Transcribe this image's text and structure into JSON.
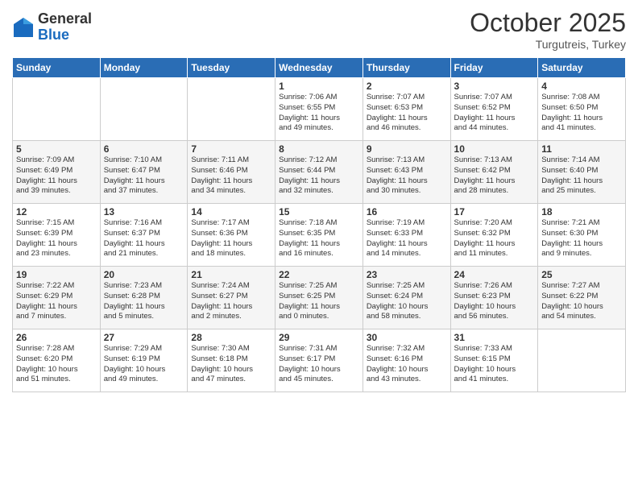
{
  "logo": {
    "general": "General",
    "blue": "Blue"
  },
  "header": {
    "month": "October 2025",
    "location": "Turgutreis, Turkey"
  },
  "days_of_week": [
    "Sunday",
    "Monday",
    "Tuesday",
    "Wednesday",
    "Thursday",
    "Friday",
    "Saturday"
  ],
  "weeks": [
    [
      {
        "day": "",
        "info": ""
      },
      {
        "day": "",
        "info": ""
      },
      {
        "day": "",
        "info": ""
      },
      {
        "day": "1",
        "info": "Sunrise: 7:06 AM\nSunset: 6:55 PM\nDaylight: 11 hours\nand 49 minutes."
      },
      {
        "day": "2",
        "info": "Sunrise: 7:07 AM\nSunset: 6:53 PM\nDaylight: 11 hours\nand 46 minutes."
      },
      {
        "day": "3",
        "info": "Sunrise: 7:07 AM\nSunset: 6:52 PM\nDaylight: 11 hours\nand 44 minutes."
      },
      {
        "day": "4",
        "info": "Sunrise: 7:08 AM\nSunset: 6:50 PM\nDaylight: 11 hours\nand 41 minutes."
      }
    ],
    [
      {
        "day": "5",
        "info": "Sunrise: 7:09 AM\nSunset: 6:49 PM\nDaylight: 11 hours\nand 39 minutes."
      },
      {
        "day": "6",
        "info": "Sunrise: 7:10 AM\nSunset: 6:47 PM\nDaylight: 11 hours\nand 37 minutes."
      },
      {
        "day": "7",
        "info": "Sunrise: 7:11 AM\nSunset: 6:46 PM\nDaylight: 11 hours\nand 34 minutes."
      },
      {
        "day": "8",
        "info": "Sunrise: 7:12 AM\nSunset: 6:44 PM\nDaylight: 11 hours\nand 32 minutes."
      },
      {
        "day": "9",
        "info": "Sunrise: 7:13 AM\nSunset: 6:43 PM\nDaylight: 11 hours\nand 30 minutes."
      },
      {
        "day": "10",
        "info": "Sunrise: 7:13 AM\nSunset: 6:42 PM\nDaylight: 11 hours\nand 28 minutes."
      },
      {
        "day": "11",
        "info": "Sunrise: 7:14 AM\nSunset: 6:40 PM\nDaylight: 11 hours\nand 25 minutes."
      }
    ],
    [
      {
        "day": "12",
        "info": "Sunrise: 7:15 AM\nSunset: 6:39 PM\nDaylight: 11 hours\nand 23 minutes."
      },
      {
        "day": "13",
        "info": "Sunrise: 7:16 AM\nSunset: 6:37 PM\nDaylight: 11 hours\nand 21 minutes."
      },
      {
        "day": "14",
        "info": "Sunrise: 7:17 AM\nSunset: 6:36 PM\nDaylight: 11 hours\nand 18 minutes."
      },
      {
        "day": "15",
        "info": "Sunrise: 7:18 AM\nSunset: 6:35 PM\nDaylight: 11 hours\nand 16 minutes."
      },
      {
        "day": "16",
        "info": "Sunrise: 7:19 AM\nSunset: 6:33 PM\nDaylight: 11 hours\nand 14 minutes."
      },
      {
        "day": "17",
        "info": "Sunrise: 7:20 AM\nSunset: 6:32 PM\nDaylight: 11 hours\nand 11 minutes."
      },
      {
        "day": "18",
        "info": "Sunrise: 7:21 AM\nSunset: 6:30 PM\nDaylight: 11 hours\nand 9 minutes."
      }
    ],
    [
      {
        "day": "19",
        "info": "Sunrise: 7:22 AM\nSunset: 6:29 PM\nDaylight: 11 hours\nand 7 minutes."
      },
      {
        "day": "20",
        "info": "Sunrise: 7:23 AM\nSunset: 6:28 PM\nDaylight: 11 hours\nand 5 minutes."
      },
      {
        "day": "21",
        "info": "Sunrise: 7:24 AM\nSunset: 6:27 PM\nDaylight: 11 hours\nand 2 minutes."
      },
      {
        "day": "22",
        "info": "Sunrise: 7:25 AM\nSunset: 6:25 PM\nDaylight: 11 hours\nand 0 minutes."
      },
      {
        "day": "23",
        "info": "Sunrise: 7:25 AM\nSunset: 6:24 PM\nDaylight: 10 hours\nand 58 minutes."
      },
      {
        "day": "24",
        "info": "Sunrise: 7:26 AM\nSunset: 6:23 PM\nDaylight: 10 hours\nand 56 minutes."
      },
      {
        "day": "25",
        "info": "Sunrise: 7:27 AM\nSunset: 6:22 PM\nDaylight: 10 hours\nand 54 minutes."
      }
    ],
    [
      {
        "day": "26",
        "info": "Sunrise: 7:28 AM\nSunset: 6:20 PM\nDaylight: 10 hours\nand 51 minutes."
      },
      {
        "day": "27",
        "info": "Sunrise: 7:29 AM\nSunset: 6:19 PM\nDaylight: 10 hours\nand 49 minutes."
      },
      {
        "day": "28",
        "info": "Sunrise: 7:30 AM\nSunset: 6:18 PM\nDaylight: 10 hours\nand 47 minutes."
      },
      {
        "day": "29",
        "info": "Sunrise: 7:31 AM\nSunset: 6:17 PM\nDaylight: 10 hours\nand 45 minutes."
      },
      {
        "day": "30",
        "info": "Sunrise: 7:32 AM\nSunset: 6:16 PM\nDaylight: 10 hours\nand 43 minutes."
      },
      {
        "day": "31",
        "info": "Sunrise: 7:33 AM\nSunset: 6:15 PM\nDaylight: 10 hours\nand 41 minutes."
      },
      {
        "day": "",
        "info": ""
      }
    ]
  ]
}
